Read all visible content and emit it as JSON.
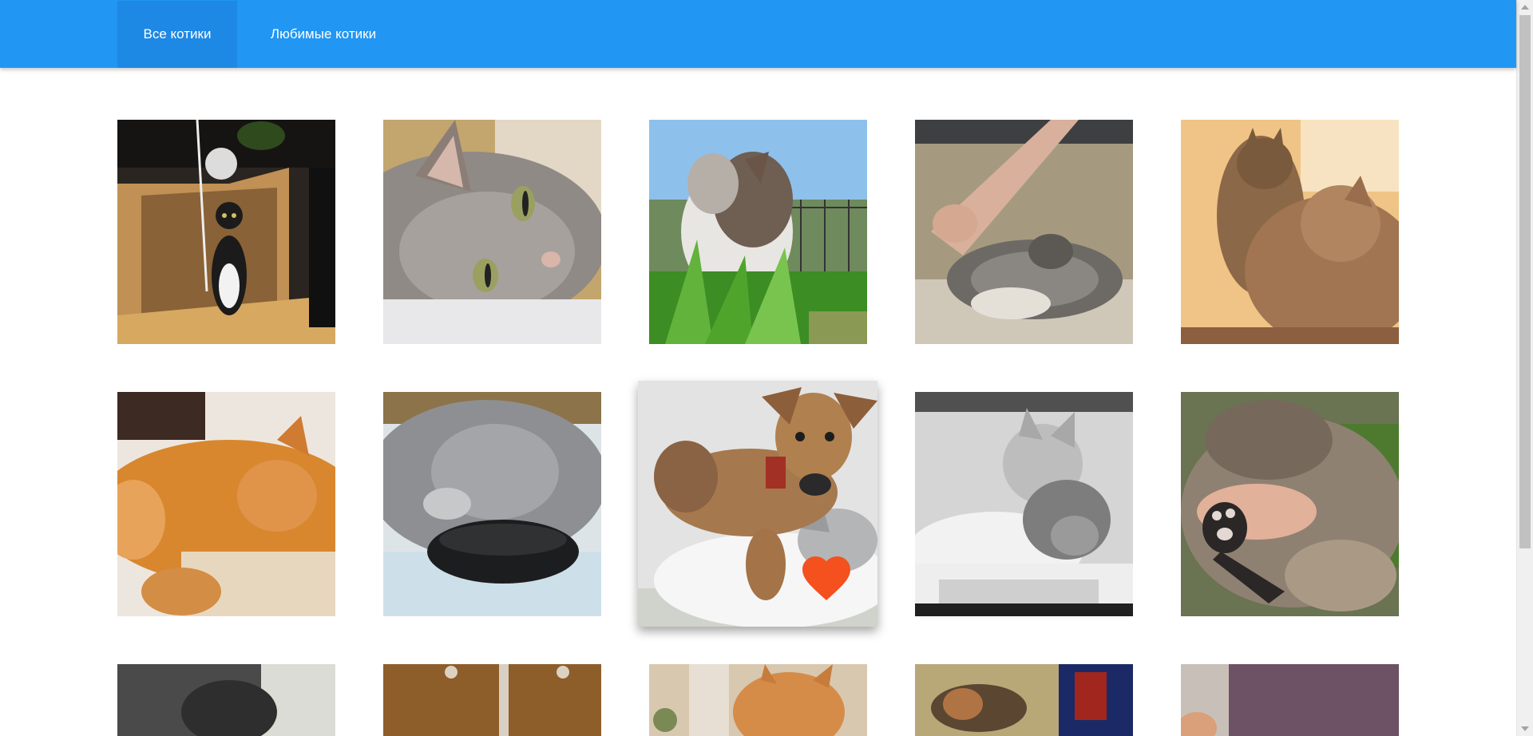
{
  "nav": {
    "tabs": [
      {
        "label": "Все котики",
        "active": true
      },
      {
        "label": "Любимые котики",
        "active": false
      }
    ],
    "background_color": "#2196f3",
    "active_tab_color": "#1e88e5"
  },
  "gallery": {
    "cards": [
      {
        "subject": "cat in a cardboard box"
      },
      {
        "subject": "grey cat lying on blanket"
      },
      {
        "subject": "cat in the grass looking up"
      },
      {
        "subject": "cat on a knitted blanket"
      },
      {
        "subject": "kitten hugging a cat"
      },
      {
        "subject": "ginger cat sleeping"
      },
      {
        "subject": "grey fluffy cat with a brush"
      },
      {
        "subject": "puppy on a kitten",
        "liked": true
      },
      {
        "subject": "two kittens black and white"
      },
      {
        "subject": "cat playing with a hand"
      },
      {
        "subject": "dark cat (partial)"
      },
      {
        "subject": "cat under a sink (partial)"
      },
      {
        "subject": "ginger kitten (partial)"
      },
      {
        "subject": "cat sleeping on a chair (partial)"
      },
      {
        "subject": "cat on a purple surface (partial)"
      }
    ],
    "like_icon": "heart-icon",
    "like_color": "#f4511e"
  }
}
